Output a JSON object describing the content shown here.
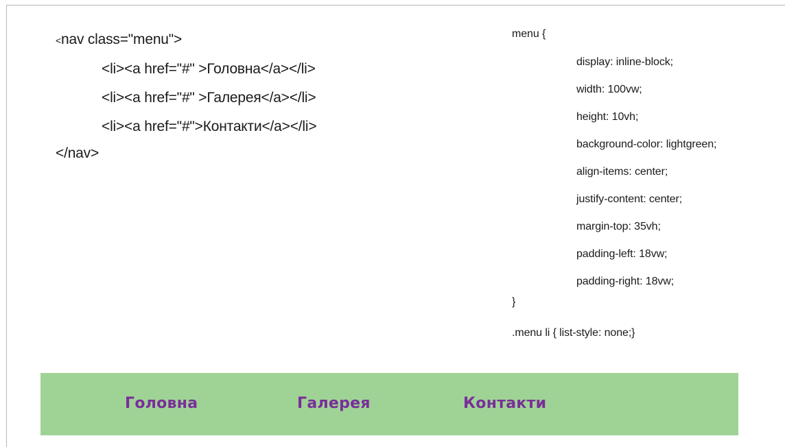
{
  "html_code": {
    "line1_lt": "<",
    "line1_rest": "nav class=\"menu\">",
    "line2": "<li><a href=\"#\" >Головна</a></li>",
    "line3": "<li><a href=\"#\" >Галерея</a></li>",
    "line4": "<li><a href=\"#\">Контакти</a></li>",
    "line5": "</nav>"
  },
  "css_code": {
    "selector_open": "menu {",
    "declarations": [
      "display: inline-block;",
      "width: 100vw;",
      "height: 10vh;",
      "background-color: lightgreen;",
      "align-items: center;",
      "justify-content: center;",
      "margin-top: 35vh;",
      "padding-left: 18vw;",
      "padding-right: 18vw;"
    ],
    "close_brace": "}",
    "li_rule": ".menu li { list-style: none;}"
  },
  "menu_demo": {
    "background_color": "#9fd395",
    "link_color": "#7a2e9a",
    "items": [
      {
        "label": "Головна"
      },
      {
        "label": "Галерея"
      },
      {
        "label": "Контакти"
      }
    ]
  }
}
